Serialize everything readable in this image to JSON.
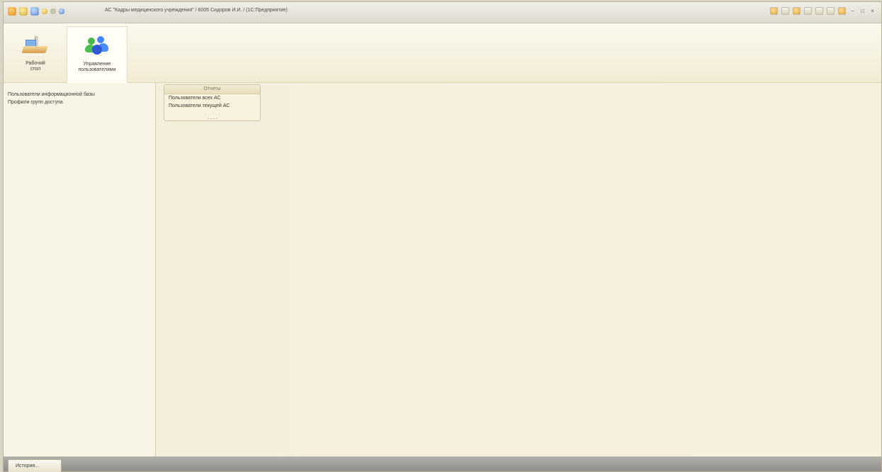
{
  "window": {
    "title": "АС \"Кадры медицинского учреждения\" / 6005 Сидоров И.И. / (1С:Предприятие)"
  },
  "sections": {
    "desktop": {
      "label_line1": "Рабочий",
      "label_line2": "стол"
    },
    "users": {
      "label_line1": "Управление",
      "label_line2": "пользователями"
    }
  },
  "left_panel": {
    "links": [
      "Пользователи информационной базы",
      "Профили групп доступа"
    ]
  },
  "reports_panel": {
    "title": "Отчеты",
    "items": [
      "Пользователи всех АС",
      "Пользователи текущей АС"
    ]
  },
  "bottom_bar": {
    "history_label": "История..."
  },
  "colors": {
    "workspace_background": "#f4efdc",
    "bottom_bar": "#9b9b95",
    "accent_green": "#48b64a",
    "accent_blue": "#3f86ff"
  },
  "icons": {
    "desktop": "desk-icon",
    "users": "users-icon"
  }
}
